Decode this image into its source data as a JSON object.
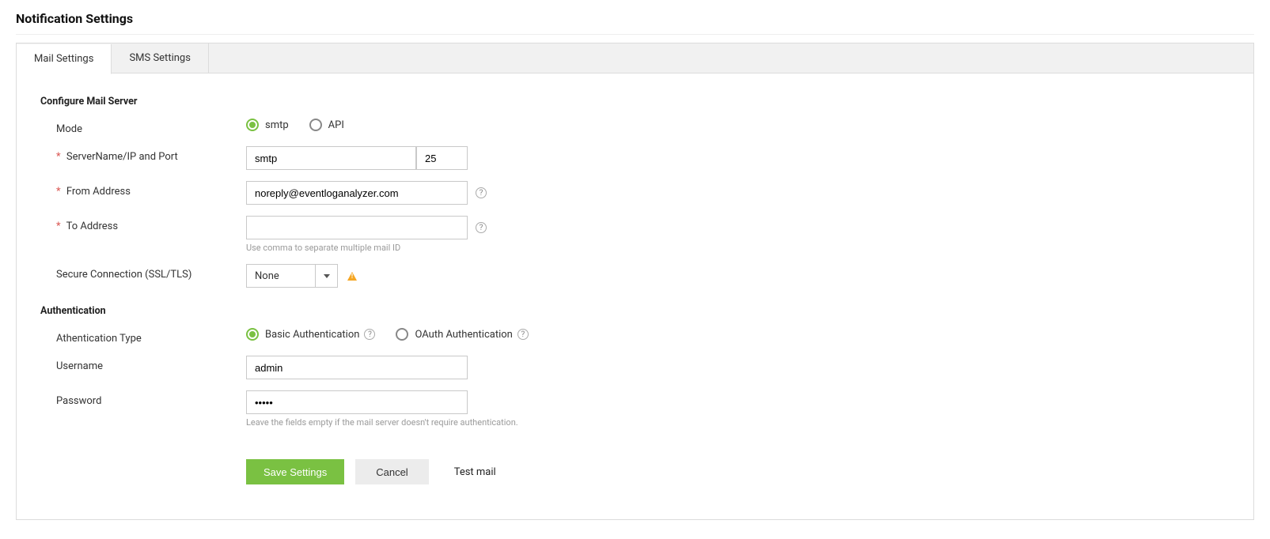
{
  "page": {
    "title": "Notification Settings"
  },
  "tabs": {
    "mail": "Mail Settings",
    "sms": "SMS Settings"
  },
  "sections": {
    "mail_server": "Configure Mail Server",
    "auth": "Authentication"
  },
  "labels": {
    "mode": "Mode",
    "server_port": "ServerName/IP and Port",
    "from_addr": "From Address",
    "to_addr": "To Address",
    "secure_conn": "Secure Connection (SSL/TLS)",
    "auth_type": "Athentication Type",
    "username": "Username",
    "password": "Password"
  },
  "mode": {
    "smtp": "smtp",
    "api": "API",
    "selected": "smtp"
  },
  "server": {
    "name": "smtp",
    "port": "25"
  },
  "from_address": "noreply@eventloganalyzer.com",
  "to_address": "",
  "to_hint": "Use comma to separate multiple mail ID",
  "secure_conn": {
    "value": "None"
  },
  "auth_type": {
    "basic": "Basic Authentication",
    "oauth": "OAuth Authentication",
    "selected": "basic"
  },
  "username": "admin",
  "password": "•••••",
  "auth_hint": "Leave the fields empty if the mail server doesn't require authentication.",
  "buttons": {
    "save": "Save Settings",
    "cancel": "Cancel",
    "test": "Test mail"
  }
}
